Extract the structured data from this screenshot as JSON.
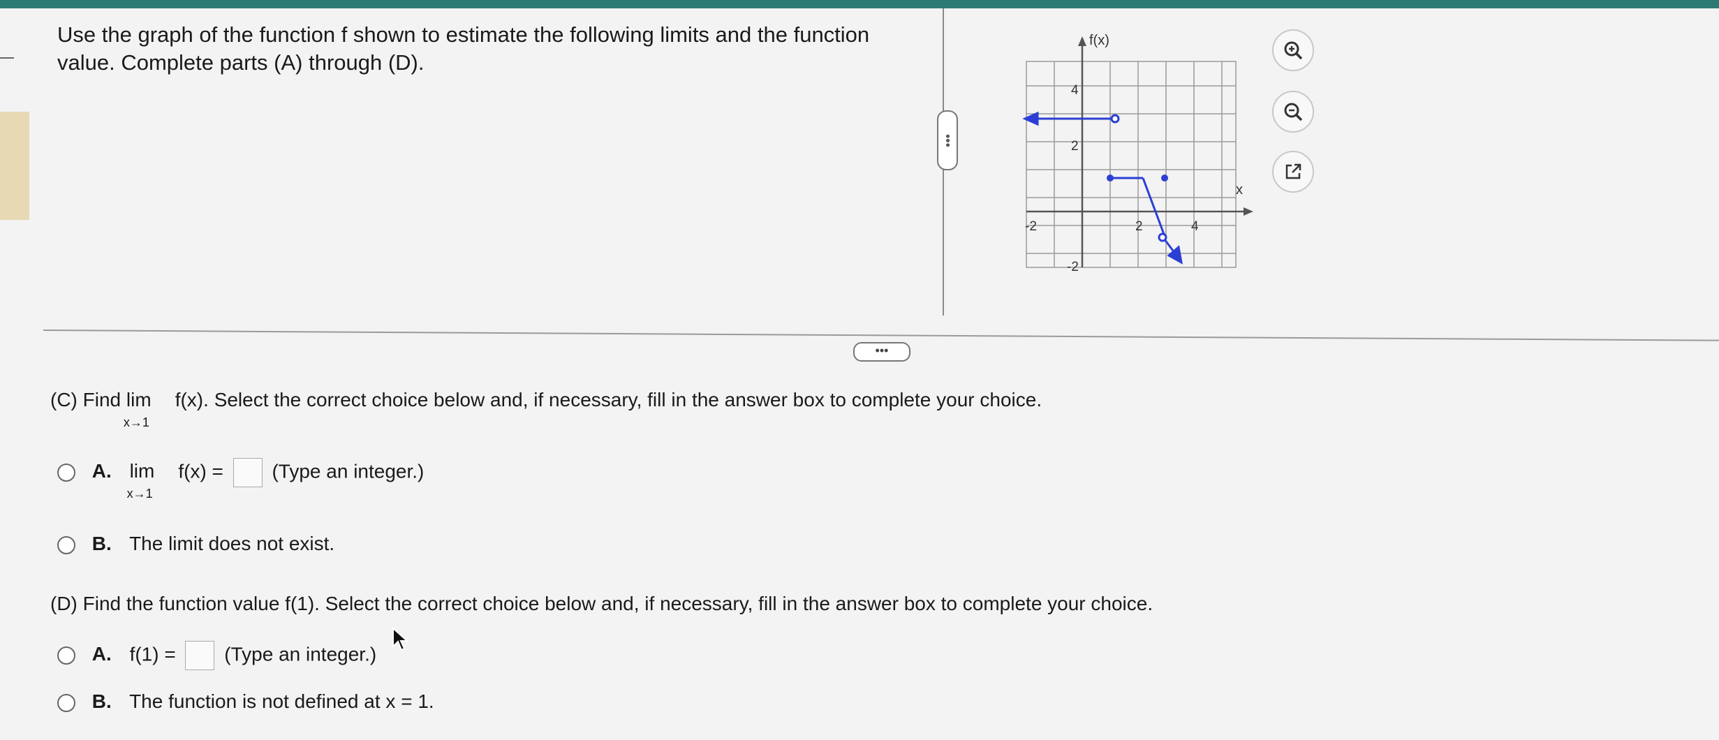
{
  "problem": {
    "instruction": "Use the graph of the function f shown to estimate the following limits and the function value. Complete parts (A) through (D)."
  },
  "graph": {
    "y_axis_label": "f(x)",
    "x_axis_label": "x",
    "y_ticks": [
      "4",
      "2",
      "-2"
    ],
    "x_ticks": [
      "-2",
      "2",
      "4"
    ],
    "line_color": "#2b3fd4"
  },
  "tools": {
    "zoom_in_icon": "zoom-in",
    "zoom_out_icon": "zoom-out",
    "popout_icon": "external-link"
  },
  "part_c": {
    "prefix": "(C) Find",
    "lim_word": "lim",
    "lim_sub": "x→1",
    "func": "f(x).",
    "instruction": "Select the correct choice below and, if necessary, fill in the answer box to complete your choice.",
    "option_a": {
      "letter": "A.",
      "lim_word": "lim",
      "lim_sub": "x→1",
      "expr": "f(x) =",
      "hint": "(Type an integer.)"
    },
    "option_b": {
      "letter": "B.",
      "text": "The limit does not exist."
    }
  },
  "part_d": {
    "prompt": "(D) Find the function value f(1). Select the correct choice below and, if necessary, fill in the answer box to complete your choice.",
    "option_a": {
      "letter": "A.",
      "expr": "f(1) =",
      "hint": "(Type an integer.)"
    },
    "option_b": {
      "letter": "B.",
      "text": "The function is not defined at x = 1."
    }
  }
}
